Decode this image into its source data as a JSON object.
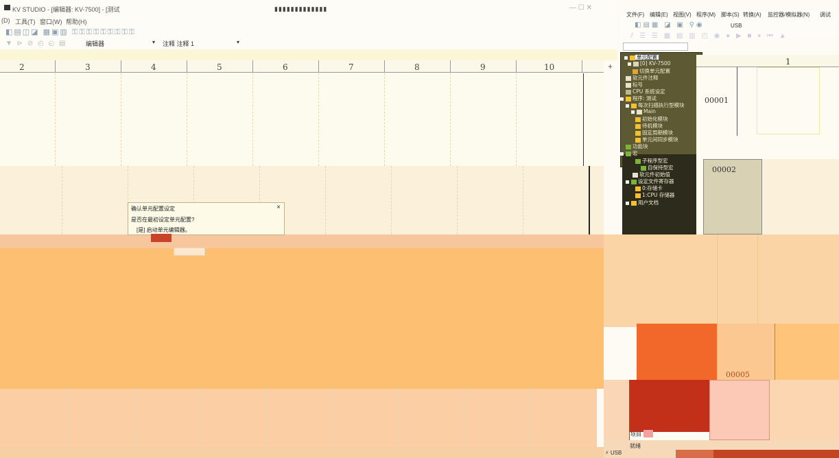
{
  "window": {
    "title": "KV STUDIO - [编辑器: KV-7500] - [测试"
  },
  "menubar": {
    "items": [
      "(D)",
      "工具(T)",
      "窗口(W)",
      "帮助(H)"
    ]
  },
  "toolbar": {
    "editor_combo": "编辑器",
    "comment_label": "注释  注释 1"
  },
  "ruler": {
    "columns": [
      "2",
      "3",
      "4",
      "5",
      "6",
      "7",
      "8",
      "9",
      "10"
    ]
  },
  "dialog": {
    "title": "确认单元配置设定",
    "close": "×",
    "question": "是否在最初设定单元配置?",
    "option": "[是]  启动单元编辑器。"
  },
  "right_menu": {
    "items": [
      "文件(F)",
      "编辑(E)",
      "视图(V)",
      "程序(M)",
      "脚本(S)",
      "转换(A)",
      "监控器/模拟器(N)",
      "调试"
    ]
  },
  "right_toolbar": {
    "usb_label": "USB"
  },
  "tree": {
    "items": [
      {
        "label": "单元配置",
        "indent": 0
      },
      {
        "label": "[0]  KV-7500",
        "indent": 1
      },
      {
        "label": "切换单元配置",
        "indent": 1
      },
      {
        "label": "软元件注释",
        "indent": 0
      },
      {
        "label": "标号",
        "indent": 0
      },
      {
        "label": "CPU 系统设定",
        "indent": 0
      },
      {
        "label": "程序: 测试",
        "indent": 0
      },
      {
        "label": "每次扫描执行型模块",
        "indent": 1
      },
      {
        "label": "Main",
        "indent": 2
      },
      {
        "label": "初始化模块",
        "indent": 1
      },
      {
        "label": "待机模块",
        "indent": 1
      },
      {
        "label": "固定周期模块",
        "indent": 1
      },
      {
        "label": "单元间同步模块",
        "indent": 1
      },
      {
        "label": "功能块",
        "indent": 0
      },
      {
        "label": "宏",
        "indent": 0
      },
      {
        "label": "子程序型宏",
        "indent": 1
      },
      {
        "label": "自保持型宏",
        "indent": 1
      },
      {
        "label": "软元件初始值",
        "indent": 0
      },
      {
        "label": "设定文件寄存器",
        "indent": 0
      },
      {
        "label": "0:存储卡",
        "indent": 1
      },
      {
        "label": "1:CPU 存储器",
        "indent": 1
      },
      {
        "label": "用户文档",
        "indent": 0
      }
    ]
  },
  "ladder": {
    "column": "1",
    "row1": "00001",
    "row2": "00002",
    "row5": "00005"
  },
  "bottom": {
    "tab_label": "项目",
    "status_ready": "就绪",
    "status_usb": "USB"
  }
}
